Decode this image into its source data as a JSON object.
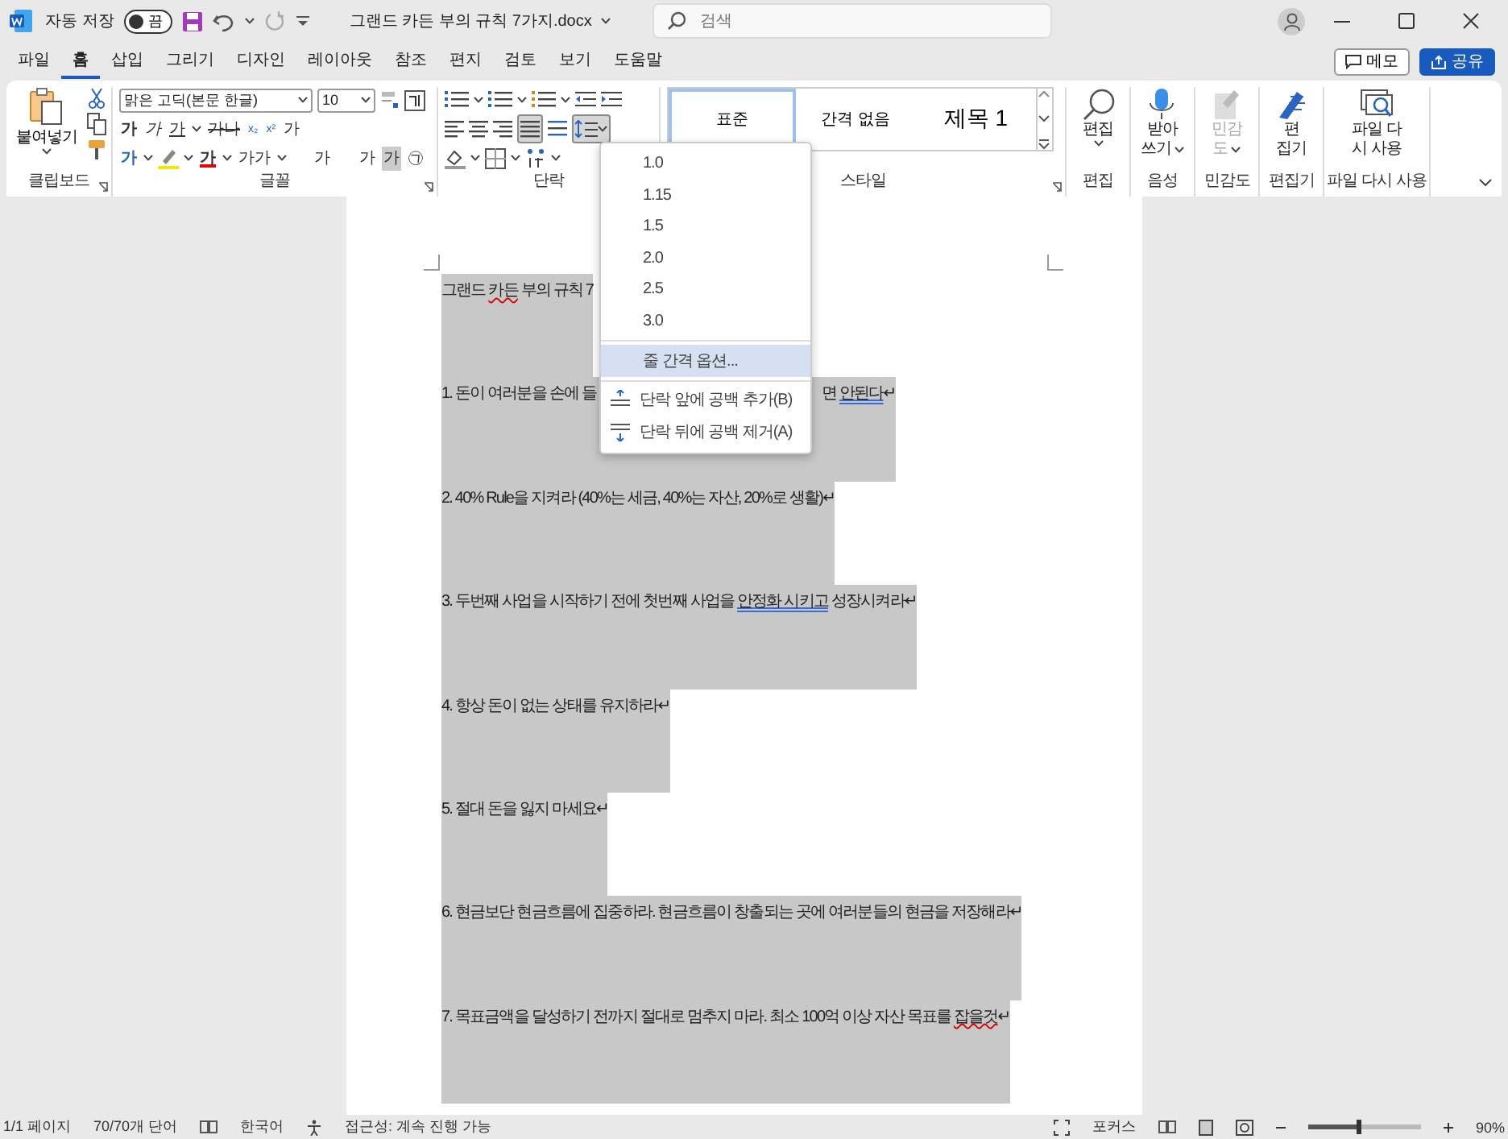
{
  "title_bar": {
    "autosave": {
      "label": "자동 저장",
      "on": false,
      "toggle_text": "끔"
    },
    "filename": "그랜드 카든 부의 규칙 7가지.docx",
    "search": {
      "placeholder": "검색"
    }
  },
  "menu_tabs": [
    {
      "label": "파일",
      "selected": false
    },
    {
      "label": "홈",
      "selected": true
    },
    {
      "label": "삽입",
      "selected": false
    },
    {
      "label": "그리기",
      "selected": false
    },
    {
      "label": "디자인",
      "selected": false
    },
    {
      "label": "레이아웃",
      "selected": false
    },
    {
      "label": "참조",
      "selected": false
    },
    {
      "label": "편지",
      "selected": false
    },
    {
      "label": "검토",
      "selected": false
    },
    {
      "label": "보기",
      "selected": false
    },
    {
      "label": "도움말",
      "selected": false
    }
  ],
  "header_buttons": [
    {
      "label": "메모",
      "kind": "comment"
    },
    {
      "label": "공유",
      "kind": "share"
    }
  ],
  "clipboard": {
    "paste_label": "붙여넣기",
    "group_label": "클립보드"
  },
  "font": {
    "font_name": "맑은 고딕(본문 한글)",
    "font_size": "10",
    "group_label": "글꼴",
    "row2": [
      {
        "glyph": "가",
        "kind": "bold"
      },
      {
        "glyph": "가",
        "kind": "italic"
      },
      {
        "glyph": "가",
        "kind": "underline"
      },
      {
        "glyph": "가나",
        "kind": "strike"
      },
      {
        "glyph": "x₂",
        "kind": "sub"
      },
      {
        "glyph": "x²",
        "kind": "sup"
      },
      {
        "glyph": "가",
        "kind": "clear"
      }
    ],
    "row3": [
      {
        "glyph": "가",
        "kind": "effect"
      },
      {
        "glyph": "가",
        "kind": "color"
      },
      {
        "glyph": "가가",
        "kind": "case"
      },
      {
        "glyph": "가",
        "kind": "grow"
      },
      {
        "glyph": "가",
        "kind": "shrink"
      },
      {
        "glyph": "가",
        "kind": "shade"
      },
      {
        "glyph": "㉠",
        "kind": "circle"
      }
    ]
  },
  "paragraph": {
    "group_label": "단락",
    "line_spacing_open": true
  },
  "styles": {
    "group_label": "스타일",
    "items": [
      {
        "label": "표준",
        "selected": true
      },
      {
        "label": "간격 없음",
        "selected": false
      },
      {
        "label": "제목 1",
        "selected": false
      }
    ]
  },
  "big_buttons": [
    {
      "kind": "find",
      "lines": [
        "편집"
      ],
      "caret": true,
      "disabled": false
    },
    {
      "kind": "dictate",
      "lines": [
        "받아",
        "쓰기"
      ],
      "caret": true,
      "disabled": false
    },
    {
      "kind": "sensitivity",
      "lines": [
        "민감",
        "도"
      ],
      "caret": true,
      "disabled": true
    },
    {
      "kind": "editor",
      "lines": [
        "편",
        "집기"
      ],
      "caret": false,
      "disabled": false
    },
    {
      "kind": "reuse",
      "lines": [
        "파일 다",
        "시 사용"
      ],
      "caret": false,
      "disabled": false
    }
  ],
  "big_group_labels": [
    "편집",
    "음성",
    "민감도",
    "편집기",
    "파일 다시 사용"
  ],
  "line_spacing_menu": {
    "values": [
      {
        "label": "1.0",
        "highlighted": false
      },
      {
        "label": "1.15",
        "highlighted": false
      },
      {
        "label": "1.5",
        "highlighted": false
      },
      {
        "label": "2.0",
        "highlighted": false
      },
      {
        "label": "2.5",
        "highlighted": false
      },
      {
        "label": "3.0",
        "highlighted": false
      },
      {
        "label": "줄 간격 옵션...",
        "highlighted": true
      }
    ],
    "actions": [
      {
        "label": "단락 앞에 공백 추가(B)",
        "kind": "add_before"
      },
      {
        "label": "단락 뒤에 공백 제거(A)",
        "kind": "remove_after"
      }
    ]
  },
  "document": {
    "paragraphs": [
      {
        "segments": [
          {
            "text": "그랜드 ",
            "kind": "plain"
          },
          {
            "text": "카든",
            "kind": "spelling"
          },
          {
            "text": " 부의 규칙 7",
            "kind": "plain"
          }
        ]
      },
      {
        "segments": [
          {
            "text": "1. 돈이 여러분을 손에 들",
            "kind": "plain"
          }
        ],
        "after": [
          {
            "text": "면 ",
            "kind": "plain"
          },
          {
            "text": "안된다",
            "kind": "grammar"
          },
          {
            "text": "↵",
            "kind": "plain"
          }
        ]
      },
      {
        "segments": [
          {
            "text": "2. 40% Rule을 지켜라 (40%는 세금, 40%는 자산, 20%로 생활)↵",
            "kind": "plain"
          }
        ]
      },
      {
        "segments": [
          {
            "text": "3. 두번째 사업을 시작하기 전에 첫번째 사업을 ",
            "kind": "plain"
          },
          {
            "text": "안정화 시키고",
            "kind": "grammar"
          },
          {
            "text": " 성장시켜라↵",
            "kind": "plain"
          }
        ]
      },
      {
        "segments": [
          {
            "text": "4. 항상 돈이 없는 상태를 유지하라↵",
            "kind": "plain"
          }
        ]
      },
      {
        "segments": [
          {
            "text": "5. 절대 돈을 잃지 마세요↵",
            "kind": "plain"
          }
        ]
      },
      {
        "segments": [
          {
            "text": "6. 현금보단 현금흐름에 집중하라. 현금흐름이 창출되는 곳에 여러분들의 현금을 저장해라↵",
            "kind": "plain"
          }
        ]
      },
      {
        "segments": [
          {
            "text": "7. 목표금액을 달성하기 전까지 절대로 멈추지 마라. 최소 100억 이상 자산 목표를 ",
            "kind": "plain"
          },
          {
            "text": "잡을것",
            "kind": "spelling"
          },
          {
            "text": "↵",
            "kind": "plain"
          }
        ]
      }
    ]
  },
  "status_bar": {
    "page": "1/1 페이지",
    "words": "70/70개 단어",
    "language": "한국어",
    "accessibility": "접근성: 계속 진행 가능",
    "focus": "포커스",
    "zoom": {
      "level": 0.45,
      "reading": "90%"
    }
  }
}
